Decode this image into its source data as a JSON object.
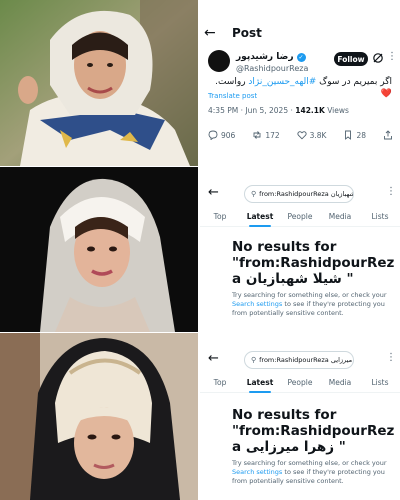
{
  "post": {
    "header_title": "Post",
    "display_name": "رضا رشیدپور",
    "handle": "@RashidpourReza",
    "follow_label": "Follow",
    "text_prefix": "اگر بمیریم در سوگ ",
    "hashtag": "#الهه_حسین_نژاد",
    "text_suffix": " رواست.",
    "translate_label": "Translate post",
    "time_date": "4:35 PM · Jun 5, 2025 · ",
    "views_count": "142.1K",
    "views_label": " Views",
    "replies": "906",
    "reposts": "172",
    "likes": "3.8K",
    "bookmarks": "28"
  },
  "searches": [
    {
      "query": "from:RashidpourReza شیلا شهبازیان",
      "tabs": [
        "Top",
        "Latest",
        "People",
        "Media",
        "Lists"
      ],
      "active_tab": "Latest",
      "no_results_line1": "No results for",
      "no_results_line2": "\"from:RashidpourRez",
      "no_results_line3": "a شیلا شهبازیان \"",
      "help_text": "Try searching for something else, or check your ",
      "help_link": "Search settings",
      "help_text2": " to see if they're protecting you from potentially sensitive content."
    },
    {
      "query": "from:RashidpourReza زهرا میرزایی",
      "tabs": [
        "Top",
        "Latest",
        "People",
        "Media",
        "Lists"
      ],
      "active_tab": "Latest",
      "no_results_line1": "No results for",
      "no_results_line2": "\"from:RashidpourRez",
      "no_results_line3": "a زهرا میرزایی \"",
      "help_text": "Try searching for something else, or check your ",
      "help_link": "Search settings",
      "help_text2": " to see if they're protecting you from potentially sensitive content."
    }
  ],
  "colors": {
    "accent": "#1d9bf0",
    "text": "#0f1419",
    "muted": "#536471"
  }
}
